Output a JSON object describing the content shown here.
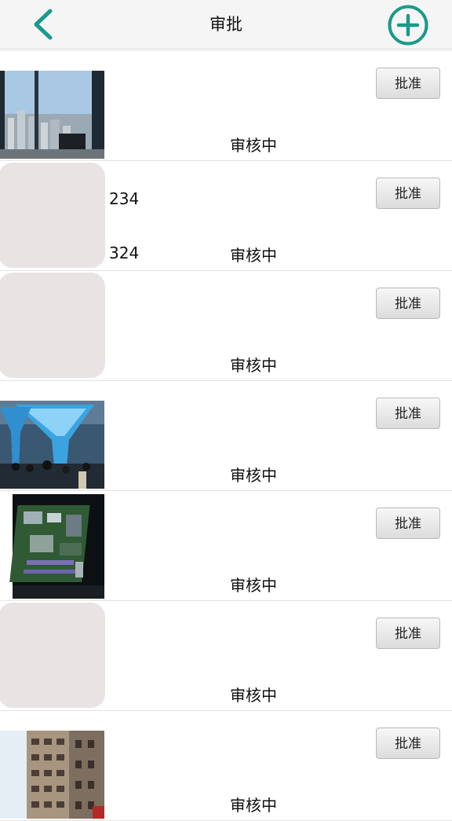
{
  "nav": {
    "title": "审批"
  },
  "colors": {
    "accent": "#1a9a8a",
    "nav_bg": "#f5f5f5",
    "placeholder": "#e8e4e4"
  },
  "icons": {
    "back": "chevron-left-icon",
    "add": "plus-circle-icon"
  },
  "items": [
    {
      "thumb": "office-window-photo",
      "line1": "",
      "line2": "",
      "status": "审核中",
      "button": "批准"
    },
    {
      "thumb": "placeholder",
      "line1": "234",
      "line2": "324",
      "status": "审核中",
      "button": "批准"
    },
    {
      "thumb": "placeholder",
      "line1": "",
      "line2": "",
      "status": "审核中",
      "button": "批准"
    },
    {
      "thumb": "exhibition-hall-photo",
      "line1": "",
      "line2": "",
      "status": "审核中",
      "button": "批准"
    },
    {
      "thumb": "circuit-board-photo",
      "line1": "",
      "line2": "",
      "status": "审核中",
      "button": "批准"
    },
    {
      "thumb": "placeholder",
      "line1": "",
      "line2": "",
      "status": "审核中",
      "button": "批准"
    },
    {
      "thumb": "building-photo",
      "line1": "",
      "line2": "",
      "status": "审核中",
      "button": "批准"
    }
  ]
}
